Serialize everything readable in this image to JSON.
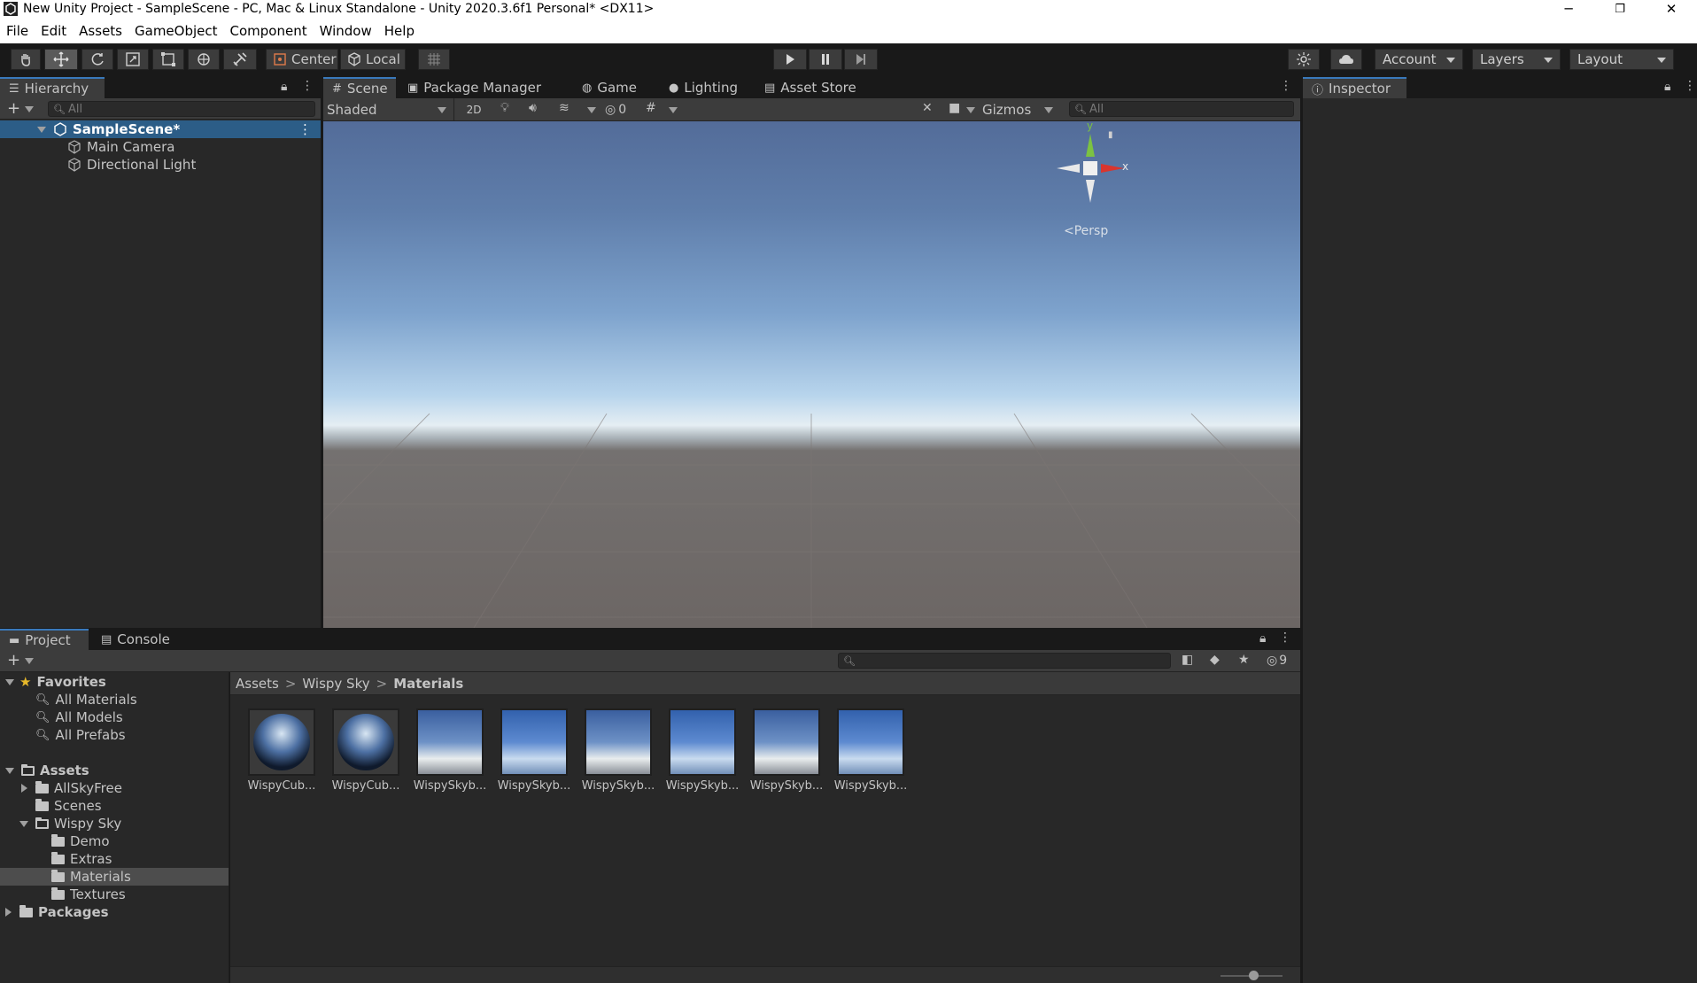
{
  "window": {
    "title": "New Unity Project - SampleScene - PC, Mac & Linux Standalone - Unity 2020.3.6f1 Personal* <DX11>",
    "minimize": "─",
    "restore": "❐",
    "close": "✕"
  },
  "menu": [
    "File",
    "Edit",
    "Assets",
    "GameObject",
    "Component",
    "Window",
    "Help"
  ],
  "toolbar": {
    "pivot": "Center",
    "space": "Local",
    "account": "Account",
    "layers": "Layers",
    "layout": "Layout"
  },
  "hierarchy": {
    "tab": "Hierarchy",
    "add": "+",
    "search_placeholder": "All",
    "scene": "SampleScene*",
    "items": [
      "Main Camera",
      "Directional Light"
    ]
  },
  "scene_tabs": [
    "Scene",
    "Package Manager",
    "Game",
    "Lighting",
    "Asset Store"
  ],
  "scene_toolbar": {
    "shading": "Shaded",
    "mode2d": "2D",
    "hidden_count": "0",
    "gizmos": "Gizmos",
    "search_placeholder": "All"
  },
  "gizmo": {
    "y": "y",
    "x": "x",
    "persp": "Persp"
  },
  "inspector": {
    "tab": "Inspector"
  },
  "bottom_tabs": [
    "Project",
    "Console"
  ],
  "project": {
    "add": "+",
    "hidden_count": "9",
    "favorites_label": "Favorites",
    "favorites": [
      "All Materials",
      "All Models",
      "All Prefabs"
    ],
    "assets_label": "Assets",
    "tree": [
      {
        "label": "AllSkyFree",
        "depth": 1
      },
      {
        "label": "Scenes",
        "depth": 1
      },
      {
        "label": "Wispy Sky",
        "depth": 1
      },
      {
        "label": "Demo",
        "depth": 2
      },
      {
        "label": "Extras",
        "depth": 2
      },
      {
        "label": "Materials",
        "depth": 2
      },
      {
        "label": "Textures",
        "depth": 2
      }
    ],
    "packages_label": "Packages",
    "breadcrumb": [
      "Assets",
      "Wispy Sky",
      "Materials"
    ],
    "assets": [
      {
        "label": "WispyCub...",
        "kind": "sphere"
      },
      {
        "label": "WispyCub...",
        "kind": "sphere"
      },
      {
        "label": "WispySkyb...",
        "kind": "sky"
      },
      {
        "label": "WispySkyb...",
        "kind": "sky2"
      },
      {
        "label": "WispySkyb...",
        "kind": "sky"
      },
      {
        "label": "WispySkyb...",
        "kind": "sky2"
      },
      {
        "label": "WispySkyb...",
        "kind": "sky"
      },
      {
        "label": "WispySkyb...",
        "kind": "sky2"
      }
    ]
  }
}
